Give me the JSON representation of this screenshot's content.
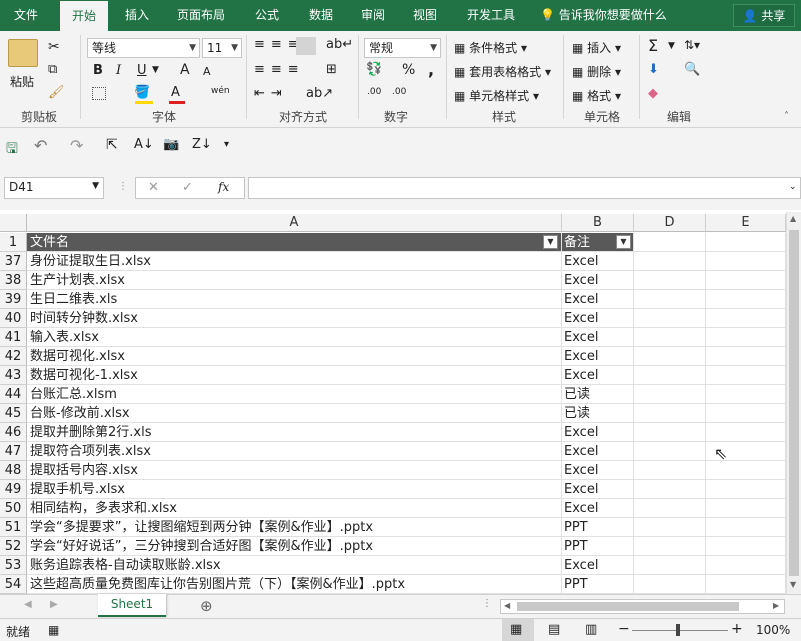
{
  "tabs": {
    "file": "文件",
    "home": "开始",
    "insert": "插入",
    "page_layout": "页面布局",
    "formulas": "公式",
    "data": "数据",
    "review": "审阅",
    "view": "视图",
    "developer": "开发工具",
    "tell_me": "告诉我你想要做什么",
    "share": "共享"
  },
  "ribbon": {
    "clipboard": {
      "paste": "粘贴",
      "label": "剪贴板"
    },
    "font": {
      "name": "等线",
      "size": "11",
      "bold": "B",
      "italic": "I",
      "underline": "U",
      "grow": "A",
      "shrink": "A",
      "phonetic": "wén",
      "label": "字体"
    },
    "alignment": {
      "label": "对齐方式"
    },
    "number": {
      "format": "常规",
      "percent": "%",
      "comma": ",",
      "inc_decimal": ".00",
      "dec_decimal": ".00",
      "label": "数字"
    },
    "styles": {
      "conditional": "条件格式",
      "table": "套用表格格式",
      "cell_styles": "单元格样式",
      "label": "样式"
    },
    "cells": {
      "insert": "插入",
      "delete": "删除",
      "format": "格式",
      "label": "单元格"
    },
    "editing": {
      "label": "编辑"
    }
  },
  "formula_bar": {
    "name_box": "D41",
    "fx": "fx",
    "formula": ""
  },
  "columns": [
    "A",
    "B",
    "D",
    "E"
  ],
  "header_row": {
    "num": "1",
    "a": "文件名",
    "b": "备注"
  },
  "rows": [
    {
      "num": "37",
      "a": "身份证提取生日.xlsx",
      "b": "Excel"
    },
    {
      "num": "38",
      "a": "生产计划表.xlsx",
      "b": "Excel"
    },
    {
      "num": "39",
      "a": "生日二维表.xls",
      "b": "Excel"
    },
    {
      "num": "40",
      "a": "时间转分钟数.xlsx",
      "b": "Excel"
    },
    {
      "num": "41",
      "a": "输入表.xlsx",
      "b": "Excel"
    },
    {
      "num": "42",
      "a": "数据可视化.xlsx",
      "b": "Excel"
    },
    {
      "num": "43",
      "a": "数据可视化-1.xlsx",
      "b": "Excel"
    },
    {
      "num": "44",
      "a": "台账汇总.xlsm",
      "b": "已读"
    },
    {
      "num": "45",
      "a": "台账-修改前.xlsx",
      "b": "已读"
    },
    {
      "num": "46",
      "a": "提取并删除第2行.xls",
      "b": "Excel"
    },
    {
      "num": "47",
      "a": "提取符合项列表.xlsx",
      "b": "Excel"
    },
    {
      "num": "48",
      "a": "提取括号内容.xlsx",
      "b": "Excel"
    },
    {
      "num": "49",
      "a": "提取手机号.xlsx",
      "b": "Excel"
    },
    {
      "num": "50",
      "a": "相同结构，多表求和.xlsx",
      "b": "Excel"
    },
    {
      "num": "51",
      "a": "学会“多提要求”，让搜图缩短到两分钟【案例&作业】.pptx",
      "b": "PPT"
    },
    {
      "num": "52",
      "a": "学会“好好说话”，三分钟搜到合适好图【案例&作业】.pptx",
      "b": "PPT"
    },
    {
      "num": "53",
      "a": "账务追踪表格-自动读取账龄.xlsx",
      "b": "Excel"
    },
    {
      "num": "54",
      "a": "这些超高质量免费图库让你告别图片荒（下）【案例&作业】.pptx",
      "b": "PPT"
    }
  ],
  "sheet_tab": "Sheet1",
  "status": {
    "ready": "就绪",
    "zoom": "100%"
  }
}
